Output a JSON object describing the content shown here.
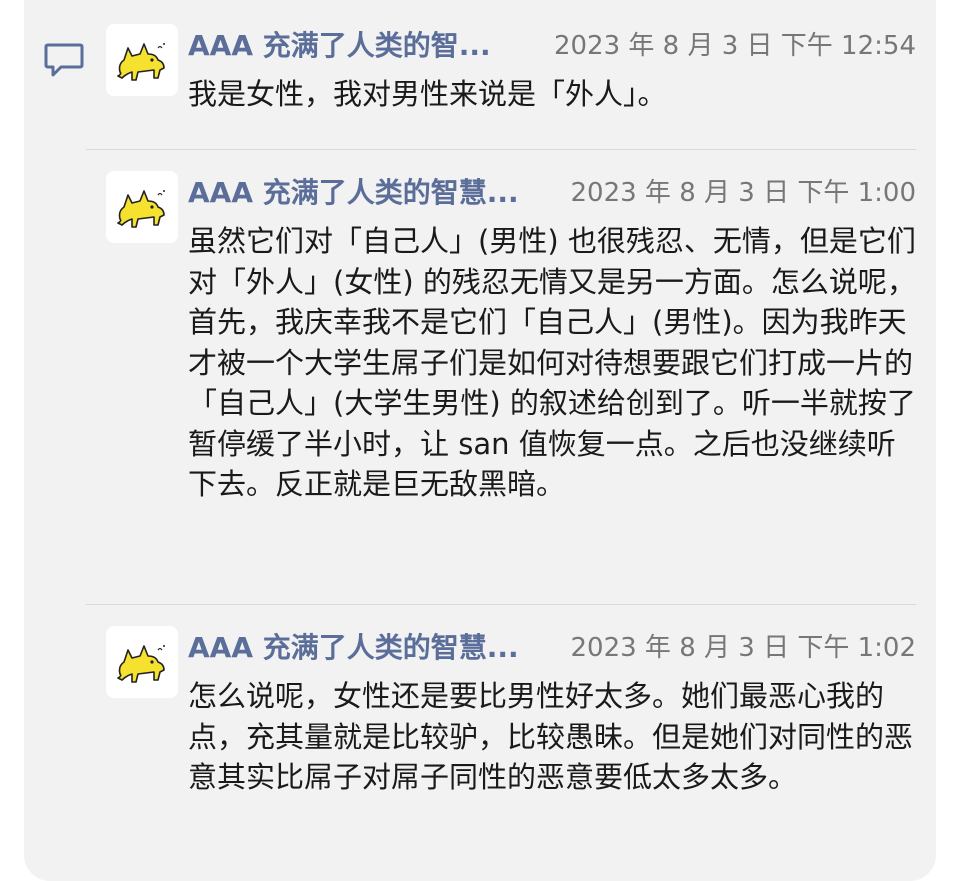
{
  "thread": {
    "icon": "comment-icon",
    "replies": [
      {
        "author": "AAA 充满了人类的智...",
        "timestamp": "2023 年 8 月 3 日  下午 12:54",
        "avatar_icon": "yellow-cat-avatar",
        "text": "我是女性，我对男性来说是「外人」。"
      },
      {
        "author": "AAA 充满了人类的智慧...",
        "timestamp": "2023 年 8 月 3 日  下午 1:00",
        "avatar_icon": "yellow-cat-avatar",
        "text": "虽然它们对「自己人」(男性) 也很残忍、无情，但是它们对「外人」(女性) 的残忍无情又是另一方面。怎么说呢，首先，我庆幸我不是它们「自己人」(男性)。因为我昨天才被一个大学生屌子们是如何对待想要跟它们打成一片的「自己人」(大学生男性) 的叙述给创到了。听一半就按了暂停缓了半小时，让 san 值恢复一点。之后也没继续听下去。反正就是巨无敌黑暗。"
      },
      {
        "author": "AAA 充满了人类的智慧...",
        "timestamp": "2023 年 8 月 3 日  下午 1:02",
        "avatar_icon": "yellow-cat-avatar",
        "text": "怎么说呢，女性还是要比男性好太多。她们最恶心我的点，充其量就是比较驴，比较愚昧。但是她们对同性的恶意其实比屌子对屌子同性的恶意要低太多太多。"
      }
    ]
  },
  "colors": {
    "panel_background": "#f2f2f2",
    "author_name": "#5b6e99",
    "timestamp": "#777777",
    "body_text": "#1a1a1a",
    "icon": "#5b6e99",
    "avatar_cat": "#f5e12e"
  }
}
